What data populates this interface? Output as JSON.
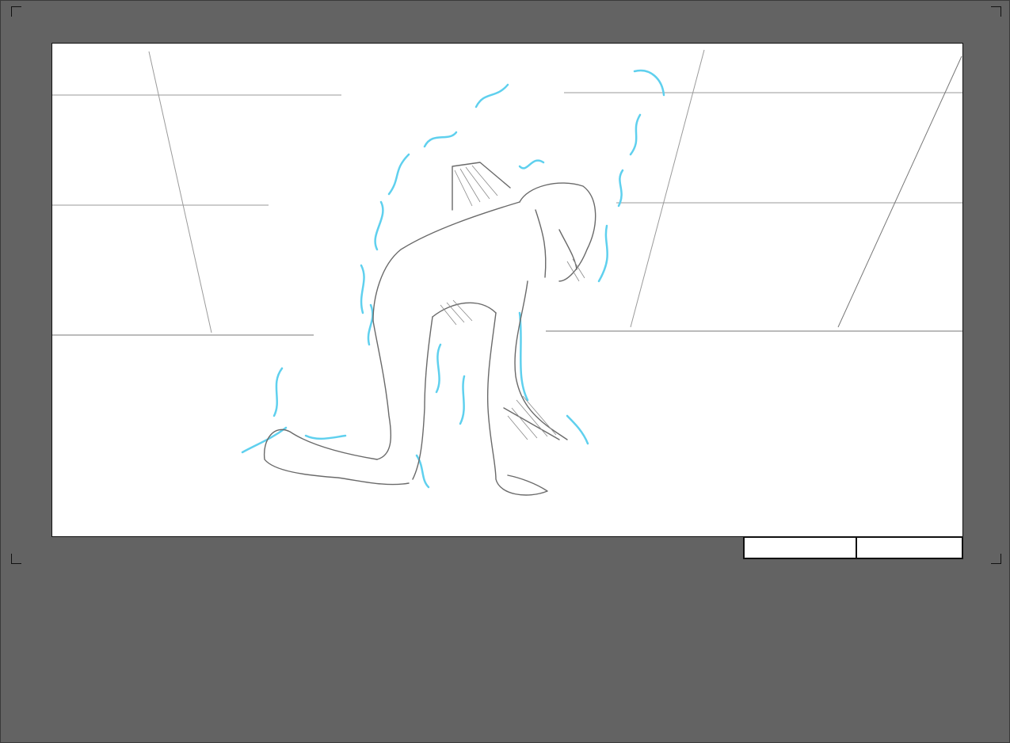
{
  "canvas": {
    "background_color": "#636363",
    "frame_color": "#ffffff",
    "border_color": "#111111",
    "pencil_color": "#8a8a8a",
    "effect_color": "#5fd0ee"
  },
  "panel": {
    "description_icon": "sketch-figure-crouching",
    "slug_fields": [
      {
        "value": ""
      },
      {
        "value": ""
      }
    ]
  }
}
